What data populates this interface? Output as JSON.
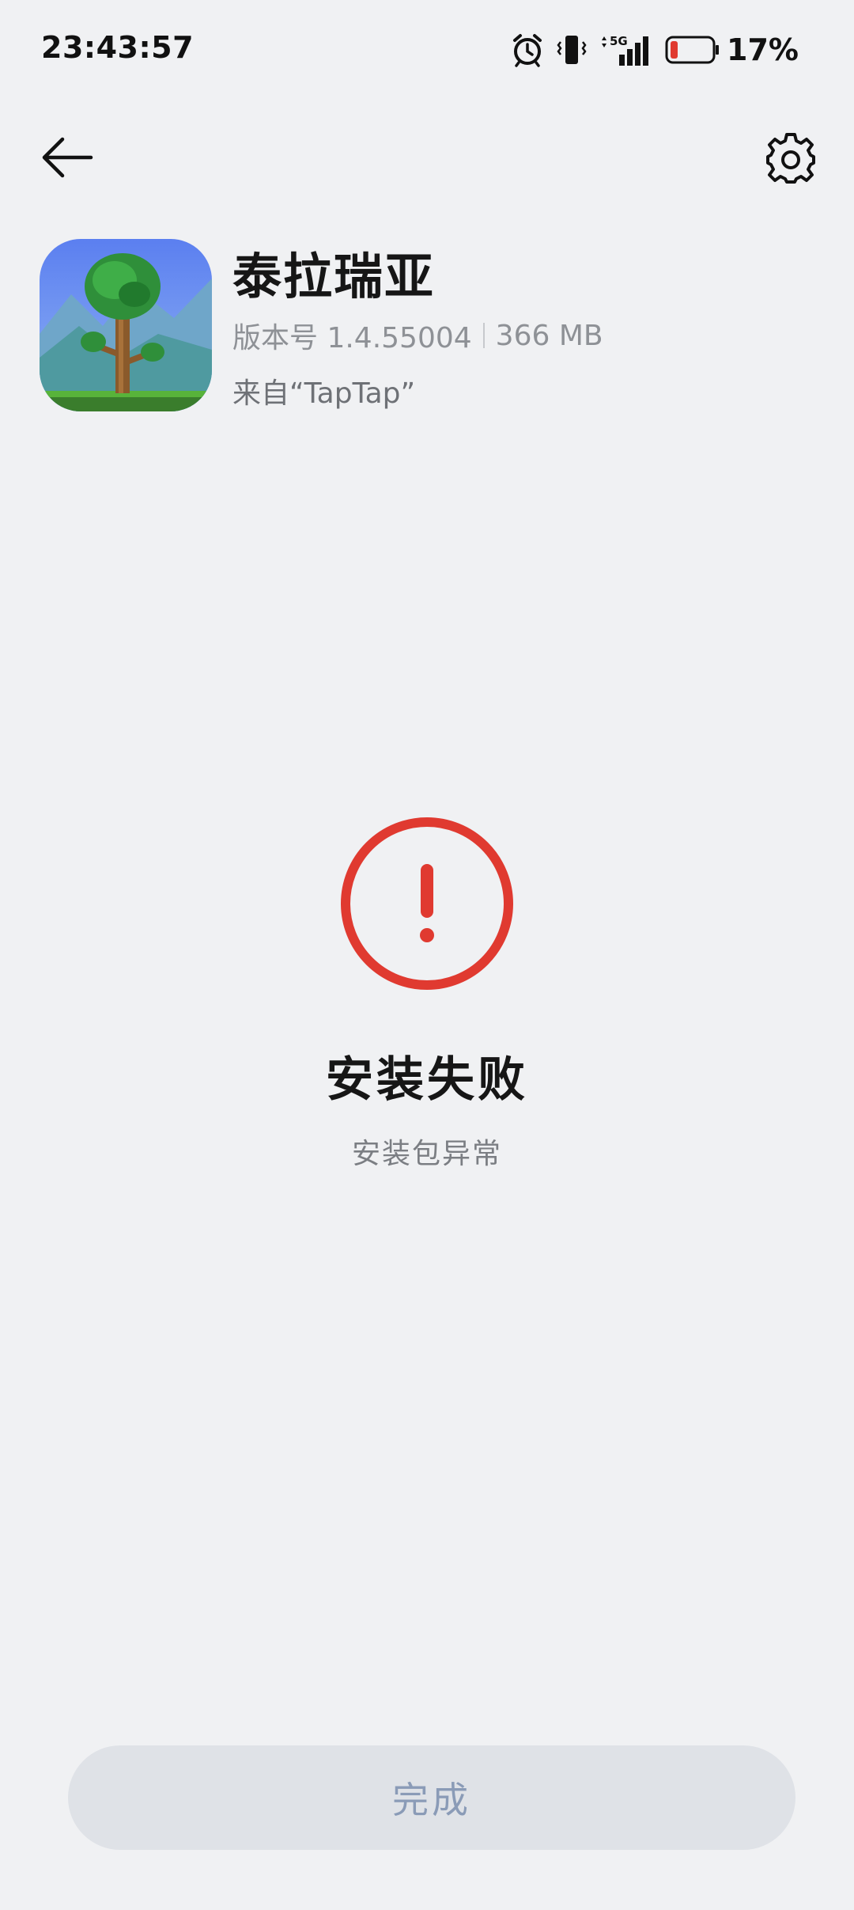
{
  "status_bar": {
    "time": "23:43:57",
    "network": "5G",
    "battery_percent": "17%",
    "battery_level": 0.17,
    "icons": [
      "alarm-icon",
      "vibrate-icon",
      "5g-signal-icon",
      "battery-icon"
    ]
  },
  "top_bar": {
    "back_icon": "arrow-left-icon",
    "settings_icon": "gear-icon"
  },
  "app": {
    "name": "泰拉瑞亚",
    "version": "版本号 1.4.55004",
    "size": "366 MB",
    "source": "来自“TapTap”",
    "icon": "terraria-tree-icon"
  },
  "result": {
    "icon": "exclamation-circle-icon",
    "title": "安装失败",
    "subtitle": "安装包异常",
    "accent_color": "#e03a30"
  },
  "actions": {
    "done_label": "完成"
  }
}
